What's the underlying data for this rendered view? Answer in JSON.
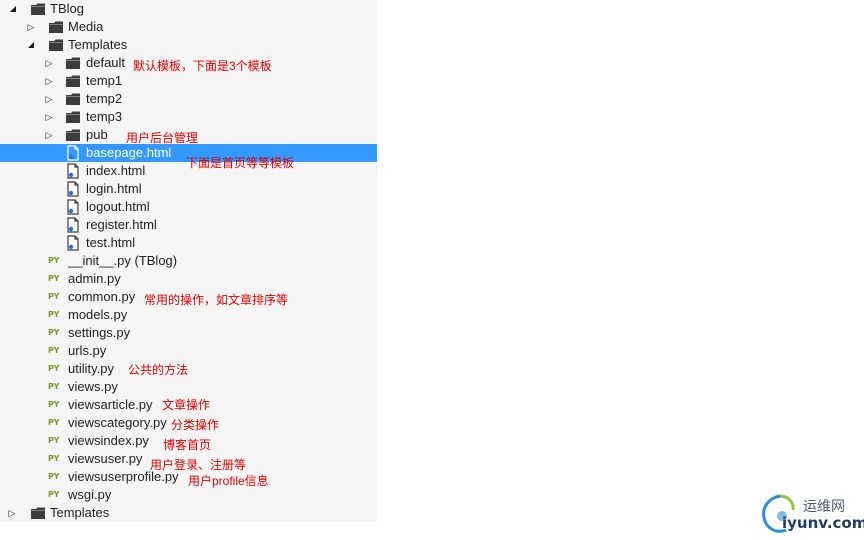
{
  "tree": {
    "items": [
      {
        "label": "TBlog",
        "kind": "folder",
        "expander": "expanded",
        "icon": "folder-icon"
      },
      {
        "label": "Media",
        "kind": "folder",
        "expander": "collapsed",
        "icon": "folder-icon"
      },
      {
        "label": "Templates",
        "kind": "folder",
        "expander": "expanded",
        "icon": "folder-icon"
      },
      {
        "label": "default",
        "kind": "folder",
        "expander": "collapsed",
        "icon": "folder-icon"
      },
      {
        "label": "temp1",
        "kind": "folder",
        "expander": "collapsed",
        "icon": "folder-icon"
      },
      {
        "label": "temp2",
        "kind": "folder",
        "expander": "collapsed",
        "icon": "folder-icon"
      },
      {
        "label": "temp3",
        "kind": "folder",
        "expander": "collapsed",
        "icon": "folder-icon"
      },
      {
        "label": "pub",
        "kind": "folder",
        "expander": "collapsed",
        "icon": "folder-icon"
      },
      {
        "label": "basepage.html",
        "kind": "html",
        "expander": "none",
        "icon": "html-file-icon",
        "selected": true
      },
      {
        "label": "index.html",
        "kind": "html",
        "expander": "none",
        "icon": "html-file-icon"
      },
      {
        "label": "login.html",
        "kind": "html",
        "expander": "none",
        "icon": "html-file-icon"
      },
      {
        "label": "logout.html",
        "kind": "html",
        "expander": "none",
        "icon": "html-file-icon"
      },
      {
        "label": "register.html",
        "kind": "html",
        "expander": "none",
        "icon": "html-file-icon"
      },
      {
        "label": "test.html",
        "kind": "html",
        "expander": "none",
        "icon": "html-file-icon"
      },
      {
        "label": "__init__.py (TBlog)",
        "kind": "py",
        "expander": "none",
        "icon": "python-file-icon"
      },
      {
        "label": "admin.py",
        "kind": "py",
        "expander": "none",
        "icon": "python-file-icon"
      },
      {
        "label": "common.py",
        "kind": "py",
        "expander": "none",
        "icon": "python-file-icon"
      },
      {
        "label": "models.py",
        "kind": "py",
        "expander": "none",
        "icon": "python-file-icon"
      },
      {
        "label": "settings.py",
        "kind": "py",
        "expander": "none",
        "icon": "python-file-icon"
      },
      {
        "label": "urls.py",
        "kind": "py",
        "expander": "none",
        "icon": "python-file-icon"
      },
      {
        "label": "utility.py",
        "kind": "py",
        "expander": "none",
        "icon": "python-file-icon"
      },
      {
        "label": "views.py",
        "kind": "py",
        "expander": "none",
        "icon": "python-file-icon"
      },
      {
        "label": "viewsarticle.py",
        "kind": "py",
        "expander": "none",
        "icon": "python-file-icon"
      },
      {
        "label": "viewscategory.py",
        "kind": "py",
        "expander": "none",
        "icon": "python-file-icon"
      },
      {
        "label": "viewsindex.py",
        "kind": "py",
        "expander": "none",
        "icon": "python-file-icon"
      },
      {
        "label": "viewsuser.py",
        "kind": "py",
        "expander": "none",
        "icon": "python-file-icon"
      },
      {
        "label": "viewsuserprofile.py",
        "kind": "py",
        "expander": "none",
        "icon": "python-file-icon"
      },
      {
        "label": "wsgi.py",
        "kind": "py",
        "expander": "none",
        "icon": "python-file-icon"
      },
      {
        "label": "Templates",
        "kind": "folder",
        "expander": "collapsed",
        "icon": "folder-icon"
      }
    ],
    "py_badge": "PY"
  },
  "notes": [
    {
      "text": "默认模板，下面是3个模板"
    },
    {
      "text": "用户后台管理"
    },
    {
      "text": "下面是首页等等模板"
    },
    {
      "text": "常用的操作，如文章排序等"
    },
    {
      "text": "公共的方法"
    },
    {
      "text": "文章操作"
    },
    {
      "text": "分类操作"
    },
    {
      "text": "博客首页"
    },
    {
      "text": "用户登录、注册等"
    },
    {
      "text": "用户profile信息"
    }
  ],
  "watermark": {
    "top_text": "运维网",
    "bottom_text": "iyunv.com"
  },
  "colors": {
    "selection": "#3399ff",
    "folder": "#3c3c3c",
    "python_badge": "#7a9a22",
    "note_text": "#e00000",
    "panel_background": "#f5f5f5"
  }
}
